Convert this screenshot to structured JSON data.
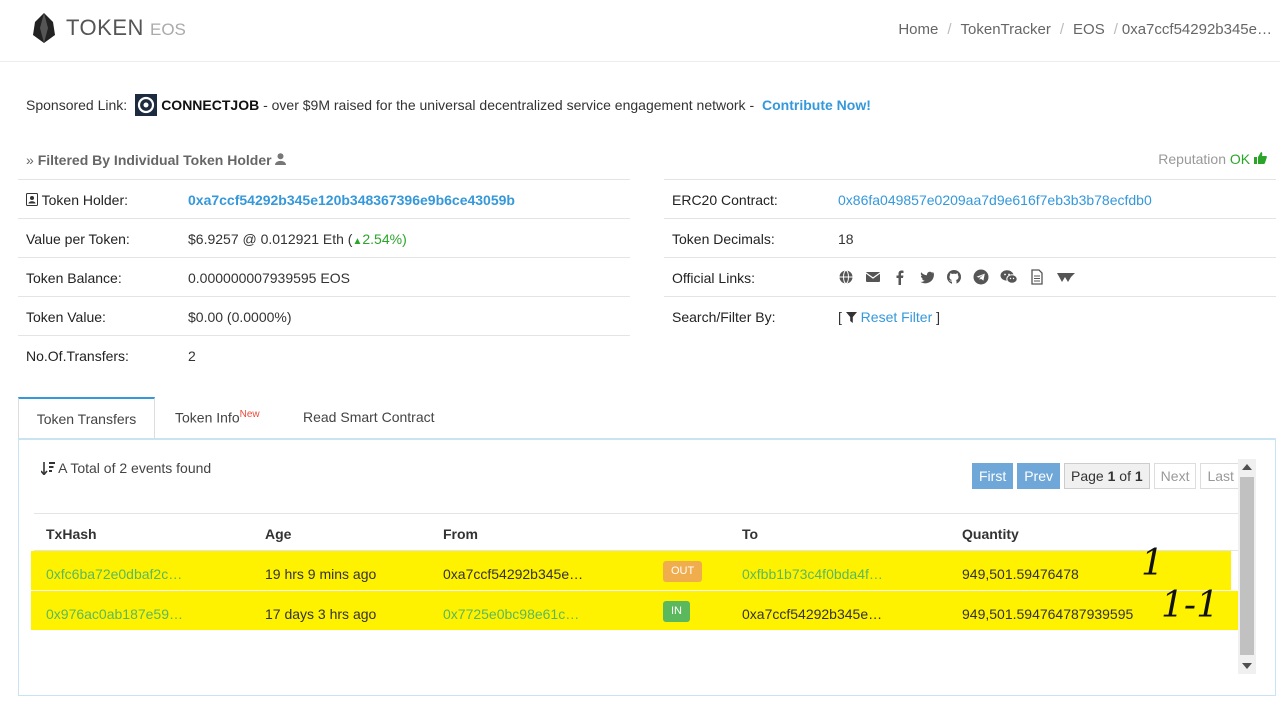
{
  "header": {
    "brand": "TOKEN",
    "brand_sub": "EOS",
    "breadcrumb": [
      "Home",
      "TokenTracker",
      "EOS",
      "0xa7ccf54292b345e…"
    ]
  },
  "sponsor": {
    "prefix": "Sponsored Link:",
    "name": "CONNECTJOB",
    "text": " - over $9M raised for the universal decentralized service engagement network - ",
    "cta": "Contribute Now!"
  },
  "filter": {
    "title": "Filtered By Individual Token Holder",
    "reputation_label": "Reputation",
    "reputation_value": "OK"
  },
  "left_details": [
    {
      "label": "Token Holder:",
      "value": "0xa7ccf54292b345e120b348367396e9b6ce43059b"
    },
    {
      "label": "Value per Token:",
      "value": "$6.9257 @ 0.012921 Eth (",
      "change": "2.54%",
      "tail": ")"
    },
    {
      "label": "Token Balance:",
      "value": "0.000000007939595 EOS"
    },
    {
      "label": "Token Value:",
      "value": "$0.00 (0.0000%)"
    },
    {
      "label": "No.Of.Transfers:",
      "value": "2"
    }
  ],
  "right_details": [
    {
      "label": "ERC20 Contract:",
      "value": "0x86fa049857e0209aa7d9e616f7eb3b3b78ecfdb0"
    },
    {
      "label": "Token Decimals:",
      "value": "18"
    },
    {
      "label": "Official Links:",
      "icons": [
        "globe-icon",
        "email-icon",
        "facebook-icon",
        "twitter-icon",
        "github-icon",
        "telegram-icon",
        "wechat-icon",
        "whitepaper-icon",
        "steemit-icon"
      ]
    },
    {
      "label": "Search/Filter By:",
      "bracket_open": "[",
      "value": "Reset Filter",
      "bracket_close": "]"
    }
  ],
  "tabs": {
    "transfers": "Token Transfers",
    "info": "Token Info",
    "info_badge": "New",
    "contract": "Read Smart Contract"
  },
  "events": {
    "summary": "A Total of 2 events found"
  },
  "pager": {
    "first": "First",
    "prev": "Prev",
    "page_label": "Page",
    "page_current": "1",
    "page_of": "of",
    "page_total": "1",
    "next": "Next",
    "last": "Last"
  },
  "table": {
    "columns": [
      "TxHash",
      "Age",
      "From",
      "To",
      "Quantity"
    ],
    "rows": [
      {
        "txhash": "0xfc6ba72e0dbaf2c…",
        "age": "19 hrs 9 mins ago",
        "from": "0xa7ccf54292b345e…",
        "direction": "OUT",
        "to": "0xfbb1b73c4f0bda4f…",
        "quantity": "949,501.59476478",
        "note": "1"
      },
      {
        "txhash": "0x976ac0ab187e59…",
        "age": "17 days 3 hrs ago",
        "from": "0x7725e0bc98e61c…",
        "direction": "IN",
        "to": "0xa7ccf54292b345e…",
        "quantity": "949,501.594764787939595",
        "note": "1-1"
      }
    ]
  },
  "colors": {
    "link": "#3498db",
    "positive": "#2aa52a",
    "highlight": "#fff200",
    "out_badge": "#f0ad4e",
    "in_badge": "#5cb85c"
  }
}
